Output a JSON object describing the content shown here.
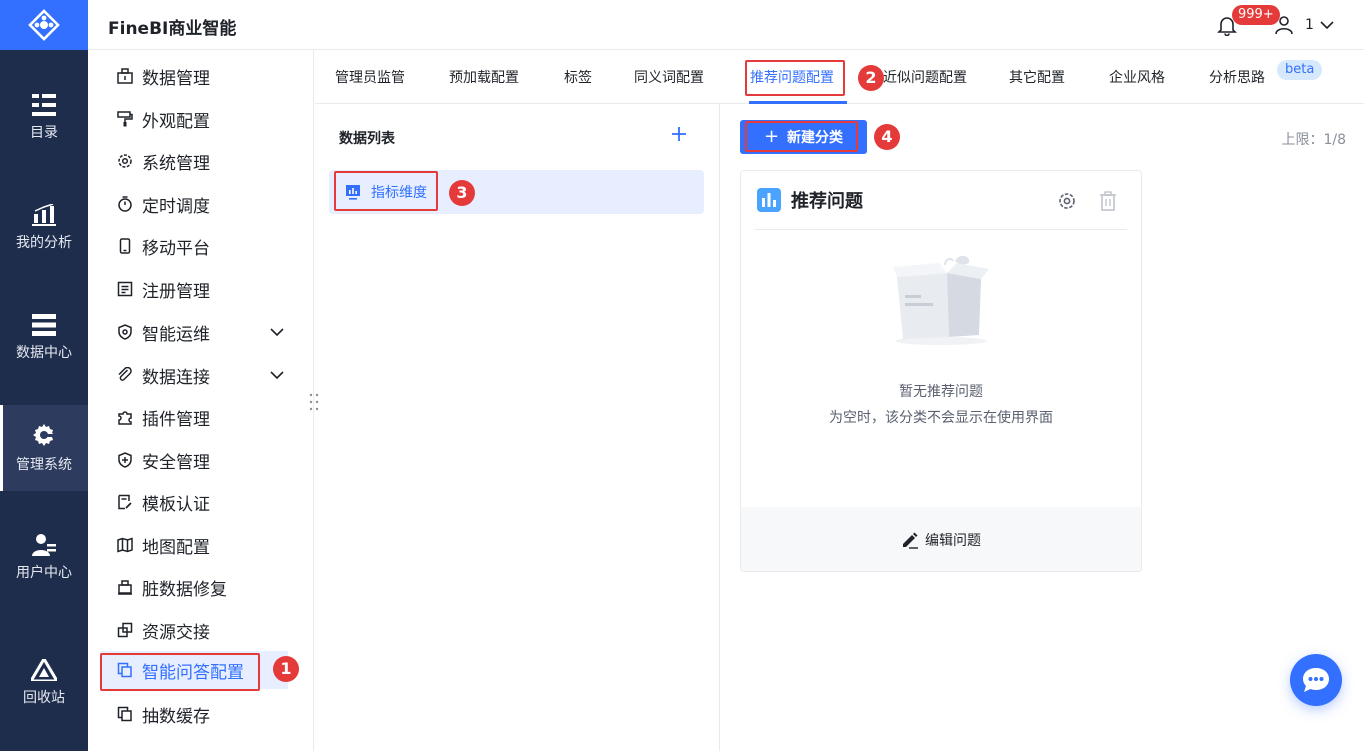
{
  "header": {
    "app_title": "FineBI商业智能",
    "notification_count": "999+",
    "user_name": "1"
  },
  "leftnav": {
    "items": [
      {
        "label": "目录",
        "icon": "catalog-icon"
      },
      {
        "label": "我的分析",
        "icon": "analysis-icon"
      },
      {
        "label": "数据中心",
        "icon": "data-center-icon"
      },
      {
        "label": "管理系统",
        "icon": "gear-icon",
        "active": true
      },
      {
        "label": "用户中心",
        "icon": "user-center-icon"
      },
      {
        "label": "回收站",
        "icon": "recycle-icon"
      }
    ]
  },
  "menu": {
    "items": [
      {
        "label": "数据管理",
        "icon": "data-management-icon"
      },
      {
        "label": "外观配置",
        "icon": "paint-roller-icon"
      },
      {
        "label": "系统管理",
        "icon": "settings-icon"
      },
      {
        "label": "定时调度",
        "icon": "stopwatch-icon"
      },
      {
        "label": "移动平台",
        "icon": "mobile-icon"
      },
      {
        "label": "注册管理",
        "icon": "register-icon"
      },
      {
        "label": "智能运维",
        "icon": "ops-icon",
        "expandable": true
      },
      {
        "label": "数据连接",
        "icon": "link-icon",
        "expandable": true
      },
      {
        "label": "插件管理",
        "icon": "puzzle-icon"
      },
      {
        "label": "安全管理",
        "icon": "shield-icon"
      },
      {
        "label": "模板认证",
        "icon": "template-icon"
      },
      {
        "label": "地图配置",
        "icon": "map-icon"
      },
      {
        "label": "脏数据修复",
        "icon": "repair-icon"
      },
      {
        "label": "资源交接",
        "icon": "handover-icon"
      },
      {
        "label": "智能问答配置",
        "icon": "qa-config-icon",
        "active": true
      },
      {
        "label": "抽数缓存",
        "icon": "cache-icon"
      }
    ]
  },
  "tabs": [
    {
      "label": "管理员监管"
    },
    {
      "label": "预加载配置"
    },
    {
      "label": "标签"
    },
    {
      "label": "同义词配置"
    },
    {
      "label": "推荐问题配置",
      "active": true
    },
    {
      "label": "近似问题配置"
    },
    {
      "label": "其它配置"
    },
    {
      "label": "企业风格"
    },
    {
      "label": "分析思路"
    }
  ],
  "beta_badge": "beta",
  "datalist": {
    "title": "数据列表",
    "items": [
      {
        "label": "指标维度"
      }
    ]
  },
  "content": {
    "new_button": "新建分类",
    "limit": "上限：1/8",
    "card": {
      "title": "推荐问题",
      "empty_title": "暂无推荐问题",
      "empty_desc": "为空时，该分类不会显示在使用界面",
      "edit_label": "编辑问题"
    }
  },
  "step_numbers": [
    "1",
    "2",
    "3",
    "4"
  ],
  "colors": {
    "accent": "#3370ff",
    "nav_bg": "#1f2d4d",
    "highlight_red": "#e43a3a",
    "active_bg": "#e6eeff"
  }
}
